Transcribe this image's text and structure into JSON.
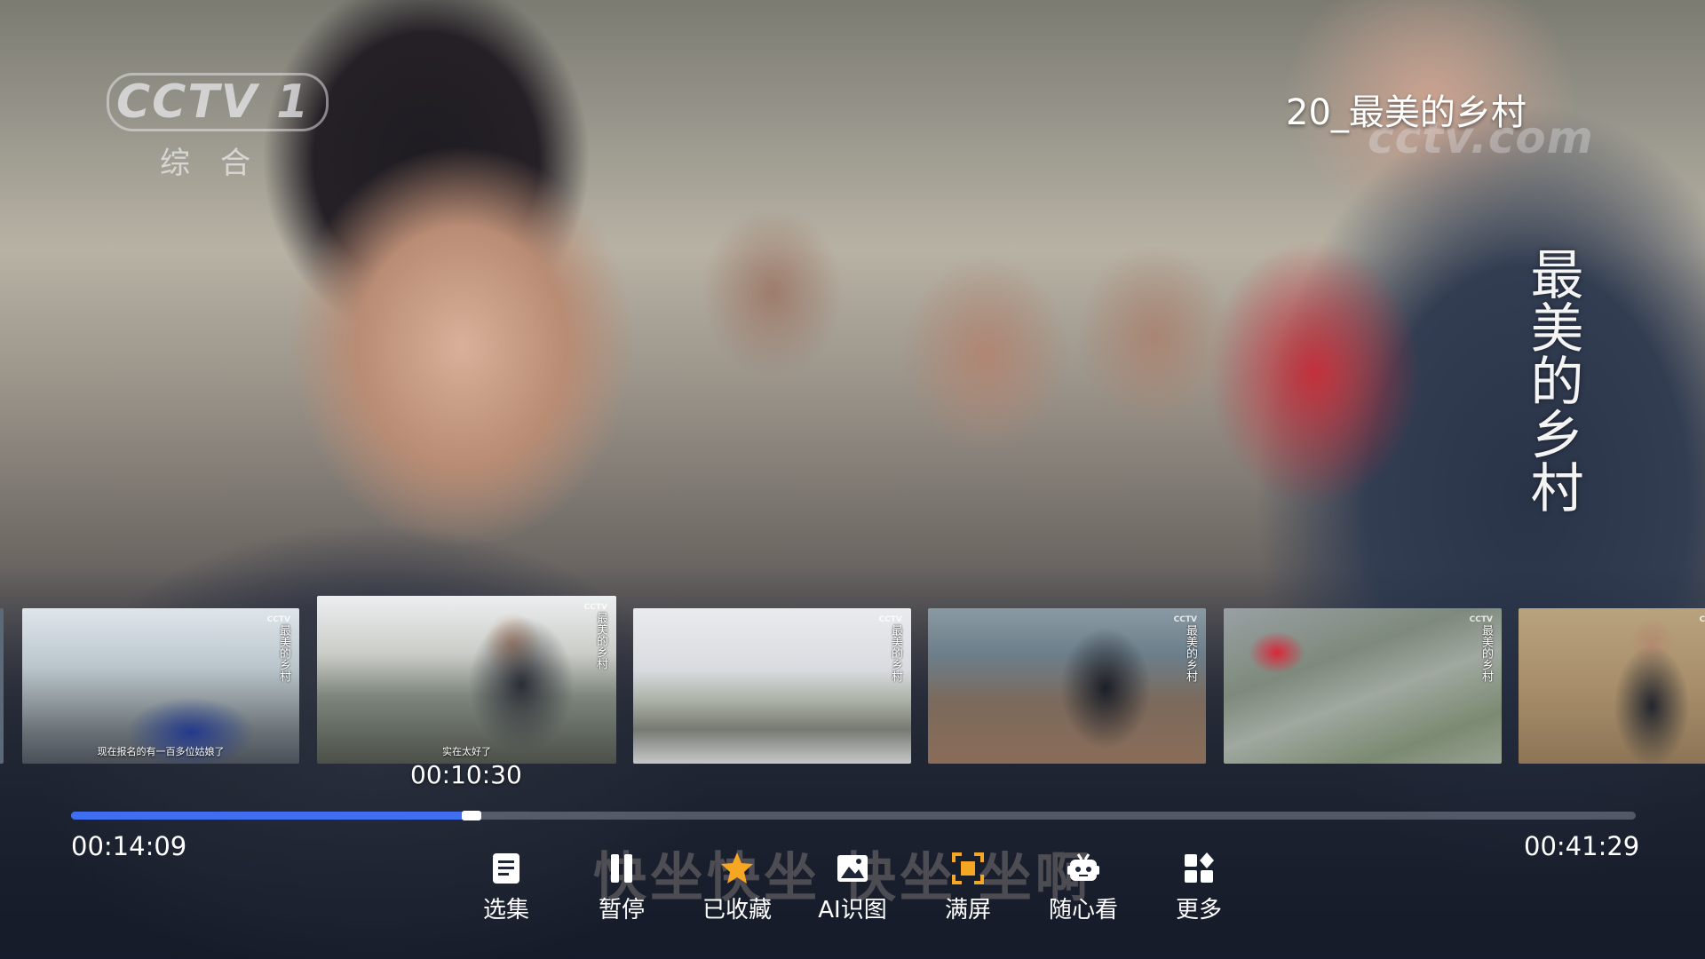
{
  "overlay": {
    "channel_brand": "CCTV 1",
    "channel_sub": "综合",
    "watermark": "cctv.com",
    "episode_title": "20_最美的乡村",
    "vertical_title": "最美的乡村"
  },
  "thumbnails": [
    {
      "caption": "",
      "vertical_text": ""
    },
    {
      "caption": "现在报名的有一百多位姑娘了",
      "vertical_text": "最美的乡村"
    },
    {
      "caption": "实在太好了",
      "vertical_text": "最美的乡村"
    },
    {
      "caption": "",
      "vertical_text": "最美的乡村"
    },
    {
      "caption": "",
      "vertical_text": "最美的乡村"
    },
    {
      "caption": "",
      "vertical_text": "最美的乡村"
    },
    {
      "caption": "",
      "vertical_text": ""
    }
  ],
  "seek_preview_time": "00:10:30",
  "playback": {
    "current_time": "00:14:09",
    "total_time": "00:41:29",
    "progress_fraction": 0.256
  },
  "subtitle_text": "快坐快坐 快坐 坐啊",
  "controls": [
    {
      "label": "选集",
      "icon": "episode-list-icon"
    },
    {
      "label": "暂停",
      "icon": "pause-icon"
    },
    {
      "label": "已收藏",
      "icon": "star-icon"
    },
    {
      "label": "AI识图",
      "icon": "image-recognition-icon"
    },
    {
      "label": "满屏",
      "icon": "fullscreen-icon"
    },
    {
      "label": "随心看",
      "icon": "robot-tv-icon"
    },
    {
      "label": "更多",
      "icon": "more-grid-icon"
    }
  ],
  "colors": {
    "accent_blue": "#3f6ff0",
    "accent_orange": "#f5a623",
    "text": "#ffffff"
  }
}
